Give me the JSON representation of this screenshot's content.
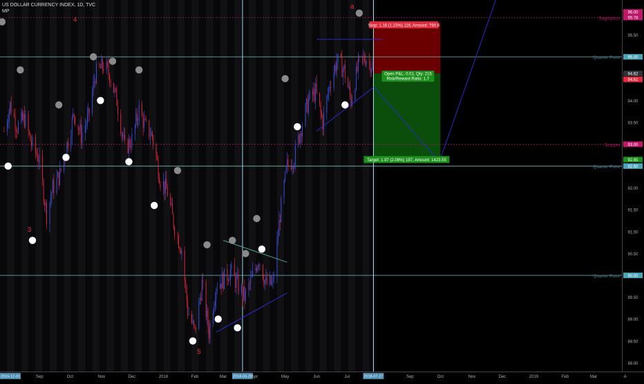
{
  "header": {
    "symbol_title": "US DOLLAR CURRENCY INDEX, 1D, TVC",
    "indicator": "MP"
  },
  "colors": {
    "background": "#000000",
    "band_light": "#111114",
    "band_dark": "#08080a",
    "up_candle": "#3a55e8",
    "down_candle": "#e8283c",
    "quarter_line": "#7fd7d7",
    "sign_line": "#c2186b",
    "stop_zone": "#6b0000",
    "target_zone": "#0b4d0b",
    "trend_line": "#2b2bcc",
    "label_red": "#e8283c",
    "label_green": "#1c8f1c",
    "axis_text": "#b0b0b0"
  },
  "chart_data": {
    "type": "candlestick",
    "ylim": [
      87.8,
      96.3
    ],
    "y_ticks": [
      88.0,
      88.5,
      89.0,
      89.5,
      90.0,
      90.5,
      91.0,
      91.5,
      92.0,
      92.5,
      93.0,
      93.5,
      94.0,
      94.5,
      95.0,
      95.5
    ],
    "x_ticks": [
      {
        "label": "2016-12-01",
        "date": "2016-12-01",
        "boxed": true
      },
      {
        "label": "Sep",
        "date": "2017-09-01"
      },
      {
        "label": "Oct",
        "date": "2017-10-01"
      },
      {
        "label": "Nov",
        "date": "2017-11-01"
      },
      {
        "label": "Dec",
        "date": "2017-12-01"
      },
      {
        "label": "2018",
        "date": "2018-01-01"
      },
      {
        "label": "Feb",
        "date": "2018-02-01"
      },
      {
        "label": "Mar",
        "date": "2018-03-01"
      },
      {
        "label": "2018-03-20",
        "date": "2018-03-20",
        "boxed": true
      },
      {
        "label": "Apr",
        "date": "2018-04-01"
      },
      {
        "label": "May",
        "date": "2018-05-01"
      },
      {
        "label": "Jun",
        "date": "2018-06-01"
      },
      {
        "label": "Jul",
        "date": "2018-07-01"
      },
      {
        "label": "2018-07-27",
        "date": "2018-07-27",
        "boxed": true
      },
      {
        "label": "Sep",
        "date": "2018-09-01"
      },
      {
        "label": "Oct",
        "date": "2018-10-01"
      },
      {
        "label": "Nov",
        "date": "2018-11-01"
      },
      {
        "label": "Dec",
        "date": "2018-12-01"
      },
      {
        "label": "2019",
        "date": "2019-01-01"
      },
      {
        "label": "Feb",
        "date": "2019-02-01"
      },
      {
        "label": "Mar",
        "date": "2019-03-01"
      },
      {
        "label": "A",
        "date": "2019-04-01"
      }
    ],
    "price_path": [
      {
        "date": "2017-07-28",
        "value": 93.3
      },
      {
        "date": "2017-08-03",
        "value": 93.9
      },
      {
        "date": "2017-08-10",
        "value": 93.4
      },
      {
        "date": "2017-08-17",
        "value": 93.6
      },
      {
        "date": "2017-08-24",
        "value": 93.0
      },
      {
        "date": "2017-08-31",
        "value": 92.7
      },
      {
        "date": "2017-09-08",
        "value": 91.4
      },
      {
        "date": "2017-09-14",
        "value": 92.0
      },
      {
        "date": "2017-09-21",
        "value": 92.3
      },
      {
        "date": "2017-09-28",
        "value": 93.0
      },
      {
        "date": "2017-10-05",
        "value": 93.7
      },
      {
        "date": "2017-10-12",
        "value": 93.2
      },
      {
        "date": "2017-10-19",
        "value": 93.6
      },
      {
        "date": "2017-10-26",
        "value": 94.6
      },
      {
        "date": "2017-11-03",
        "value": 94.8
      },
      {
        "date": "2017-11-09",
        "value": 94.6
      },
      {
        "date": "2017-11-16",
        "value": 94.0
      },
      {
        "date": "2017-11-24",
        "value": 92.9
      },
      {
        "date": "2017-12-01",
        "value": 93.1
      },
      {
        "date": "2017-12-08",
        "value": 93.8
      },
      {
        "date": "2017-12-14",
        "value": 93.4
      },
      {
        "date": "2017-12-21",
        "value": 93.2
      },
      {
        "date": "2017-12-29",
        "value": 92.2
      },
      {
        "date": "2018-01-05",
        "value": 91.9
      },
      {
        "date": "2018-01-12",
        "value": 91.1
      },
      {
        "date": "2018-01-19",
        "value": 90.6
      },
      {
        "date": "2018-01-25",
        "value": 89.2
      },
      {
        "date": "2018-02-01",
        "value": 88.7
      },
      {
        "date": "2018-02-08",
        "value": 89.8
      },
      {
        "date": "2018-02-15",
        "value": 88.7
      },
      {
        "date": "2018-02-22",
        "value": 89.8
      },
      {
        "date": "2018-03-01",
        "value": 89.9
      },
      {
        "date": "2018-03-08",
        "value": 90.1
      },
      {
        "date": "2018-03-15",
        "value": 89.8
      },
      {
        "date": "2018-03-22",
        "value": 89.5
      },
      {
        "date": "2018-03-29",
        "value": 89.9
      },
      {
        "date": "2018-04-05",
        "value": 90.4
      },
      {
        "date": "2018-04-12",
        "value": 89.8
      },
      {
        "date": "2018-04-19",
        "value": 89.8
      },
      {
        "date": "2018-04-26",
        "value": 91.4
      },
      {
        "date": "2018-05-03",
        "value": 92.5
      },
      {
        "date": "2018-05-10",
        "value": 92.7
      },
      {
        "date": "2018-05-17",
        "value": 93.4
      },
      {
        "date": "2018-05-24",
        "value": 94.0
      },
      {
        "date": "2018-05-31",
        "value": 94.2
      },
      {
        "date": "2018-06-07",
        "value": 93.5
      },
      {
        "date": "2018-06-14",
        "value": 94.4
      },
      {
        "date": "2018-06-21",
        "value": 94.9
      },
      {
        "date": "2018-06-28",
        "value": 94.7
      },
      {
        "date": "2018-07-05",
        "value": 94.0
      },
      {
        "date": "2018-07-12",
        "value": 94.8
      },
      {
        "date": "2018-07-19",
        "value": 95.0
      },
      {
        "date": "2018-07-26",
        "value": 94.8
      }
    ],
    "horizontal_lines": [
      {
        "name": "Sagittarius",
        "value": 95.9,
        "kind": "sign",
        "price_label": "95.78",
        "secondary_label": "96.00"
      },
      {
        "name": "Quarter Point",
        "value": 95.0,
        "kind": "quarter",
        "price_label": "95.00"
      },
      {
        "name": "Scorpio",
        "value": 93.0,
        "kind": "sign",
        "price_label": "93.00"
      },
      {
        "name": "Quarter Point",
        "value": 92.5,
        "kind": "quarter",
        "price_label": "92.50"
      },
      {
        "name": "Quarter Point",
        "value": 90.0,
        "kind": "quarter",
        "price_label": "90.00"
      }
    ],
    "price_markers": [
      {
        "value": 94.62,
        "label": "94.62",
        "color": "#2f3236"
      },
      {
        "value": 94.61,
        "label": "94.61",
        "color": "#e8283c"
      },
      {
        "value": 92.65,
        "label": "92.65",
        "color": "#1c8f1c"
      }
    ],
    "vertical_lines": [
      {
        "date": "2018-03-20",
        "color": "#9edcf0"
      },
      {
        "date": "2018-07-27",
        "color": "#b8e3f2"
      }
    ],
    "position": {
      "start": "2018-07-27",
      "end": "2018-10-01",
      "entry": 94.62,
      "stop": 95.78,
      "target": 92.65,
      "stop_label": "Stop: 1.16 (1.23%) 116, Amount: 790.6",
      "open_label": "Open P&L: 0.01, Qty: 215",
      "ratio_label": "Risk/Reward Ratio: 1.7",
      "target_label": "Target: 1.97 (2.08%) 197, Amount: 1423.55"
    },
    "trend_lines": [
      {
        "from": {
          "date": "2018-02-22",
          "value": 88.7
        },
        "to": {
          "date": "2018-05-03",
          "value": 89.6
        },
        "color": "#2b2bcc"
      },
      {
        "from": {
          "date": "2018-03-01",
          "value": 90.8
        },
        "to": {
          "date": "2018-05-03",
          "value": 90.3
        },
        "color": "#4fa58a"
      },
      {
        "from": {
          "date": "2018-06-01",
          "value": 93.3
        },
        "to": {
          "date": "2018-07-27",
          "value": 94.3
        },
        "color": "#2b2bcc"
      },
      {
        "from": {
          "date": "2018-06-01",
          "value": 95.4
        },
        "to": {
          "date": "2018-08-05",
          "value": 95.4
        },
        "color": "#2b2bcc"
      },
      {
        "from": {
          "date": "2018-07-28",
          "value": 94.3
        },
        "to": {
          "date": "2018-09-30",
          "value": 92.6
        },
        "color": "#2b2bcc"
      },
      {
        "from": {
          "date": "2018-09-30",
          "value": 92.6
        },
        "to": {
          "date": "2018-12-05",
          "value": 97.0
        },
        "color": "#2b2bcc"
      }
    ],
    "planet_markers": [
      {
        "date": "2017-07-26",
        "value": 95.8,
        "color": "gray"
      },
      {
        "date": "2017-08-01",
        "value": 92.5,
        "color": "white"
      },
      {
        "date": "2017-08-13",
        "value": 94.7,
        "color": "gray"
      },
      {
        "date": "2017-08-25",
        "value": 90.8,
        "color": "white"
      },
      {
        "date": "2017-09-20",
        "value": 93.9,
        "color": "gray"
      },
      {
        "date": "2017-09-27",
        "value": 92.7,
        "color": "white"
      },
      {
        "date": "2017-10-24",
        "value": 95.0,
        "color": "gray"
      },
      {
        "date": "2017-10-31",
        "value": 94.0,
        "color": "white"
      },
      {
        "date": "2017-11-12",
        "value": 94.9,
        "color": "gray"
      },
      {
        "date": "2017-11-28",
        "value": 92.6,
        "color": "white"
      },
      {
        "date": "2017-12-08",
        "value": 94.7,
        "color": "gray"
      },
      {
        "date": "2017-12-23",
        "value": 91.6,
        "color": "white"
      },
      {
        "date": "2018-01-15",
        "value": 92.4,
        "color": "gray"
      },
      {
        "date": "2018-01-30",
        "value": 88.5,
        "color": "white"
      },
      {
        "date": "2018-02-13",
        "value": 90.7,
        "color": "gray"
      },
      {
        "date": "2018-02-24",
        "value": 89.0,
        "color": "white"
      },
      {
        "date": "2018-03-10",
        "value": 90.8,
        "color": "gray"
      },
      {
        "date": "2018-03-15",
        "value": 88.8,
        "color": "white"
      },
      {
        "date": "2018-03-23",
        "value": 90.5,
        "color": "gray"
      },
      {
        "date": "2018-04-03",
        "value": 91.3,
        "color": "gray"
      },
      {
        "date": "2018-04-08",
        "value": 90.6,
        "color": "white"
      },
      {
        "date": "2018-05-01",
        "value": 94.5,
        "color": "gray"
      },
      {
        "date": "2018-05-13",
        "value": 93.4,
        "color": "white"
      },
      {
        "date": "2018-06-29",
        "value": 93.9,
        "color": "white"
      },
      {
        "date": "2018-07-13",
        "value": 96.0,
        "color": "gray"
      }
    ],
    "wave_labels": [
      {
        "text": "4",
        "date": "2017-10-06",
        "value": 95.8
      },
      {
        "text": "3",
        "date": "2017-08-22",
        "value": 91.0
      },
      {
        "text": "5",
        "date": "2018-02-05",
        "value": 88.2
      },
      {
        "text": "a",
        "date": "2018-07-06",
        "value": 96.1
      }
    ]
  }
}
